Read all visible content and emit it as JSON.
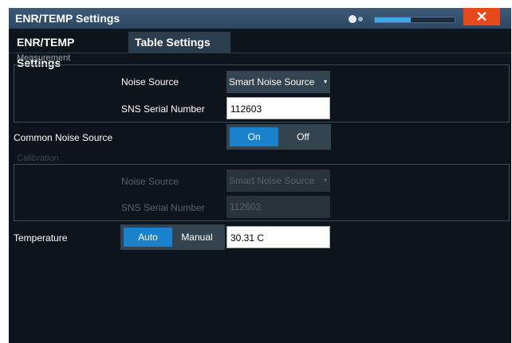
{
  "window": {
    "title": "ENR/TEMP Settings",
    "close_label": "✕",
    "transparency_level": 0.45
  },
  "tabs": [
    {
      "label": "ENR/TEMP Settings",
      "active": true
    },
    {
      "label": "Table Settings",
      "active": false
    }
  ],
  "measurement": {
    "section_label": "Measurement",
    "noise_source_label": "Noise Source",
    "noise_source_value": "Smart Noise Source",
    "serial_label": "SNS Serial Number",
    "serial_value": "112603"
  },
  "common_noise_source": {
    "label": "Common Noise Source",
    "options": [
      "On",
      "Off"
    ],
    "selected": "On"
  },
  "calibration": {
    "section_label": "Calibration",
    "noise_source_label": "Noise Source",
    "noise_source_value": "Smart Noise Source",
    "serial_label": "SNS Serial Number",
    "serial_value": "112603",
    "disabled": true
  },
  "temperature": {
    "label": "Temperature",
    "options": [
      "Auto",
      "Manual"
    ],
    "selected": "Auto",
    "value": "30.31 C"
  },
  "colors": {
    "accent": "#1a82cc",
    "close": "#e8491a",
    "background": "#0e141b"
  },
  "icons": {
    "caret": "▾",
    "transparency": "toggle-icon"
  }
}
